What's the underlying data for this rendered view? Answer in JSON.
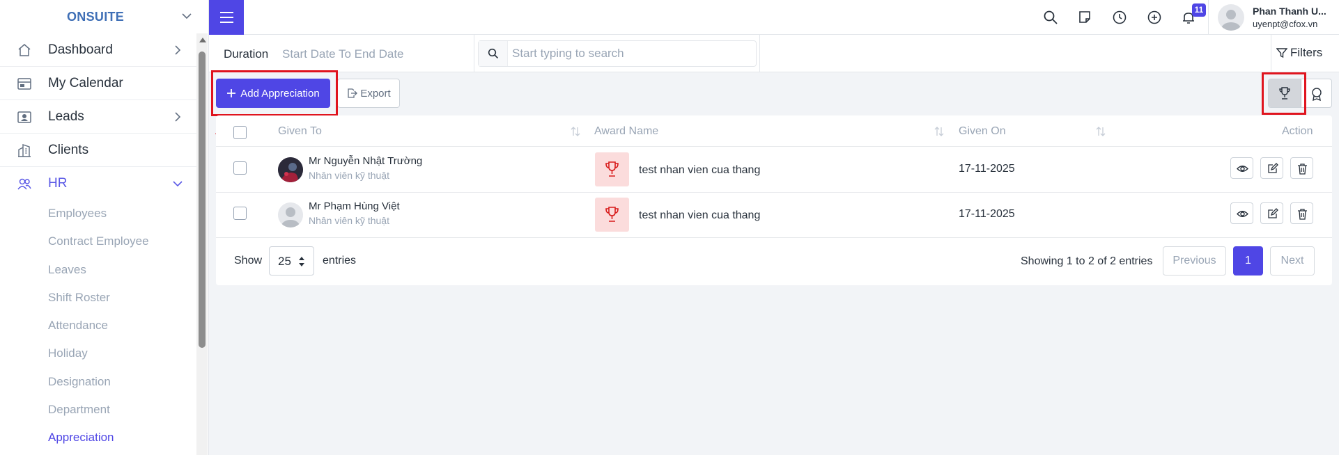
{
  "sidebar": {
    "brand": "ONSUITE",
    "menu": [
      {
        "label": "Dashboard",
        "icon": "home-icon"
      },
      {
        "label": "My Calendar",
        "icon": "calendar-icon"
      },
      {
        "label": "Leads",
        "icon": "leads-icon"
      },
      {
        "label": "Clients",
        "icon": "building-icon"
      },
      {
        "label": "HR",
        "icon": "users-icon"
      }
    ],
    "hr_submenu": [
      "Employees",
      "Contract Employee",
      "Leaves",
      "Shift Roster",
      "Attendance",
      "Holiday",
      "Designation",
      "Department",
      "Appreciation"
    ]
  },
  "topbar": {
    "notification_count": "11",
    "user_name": "Phan Thanh U...",
    "user_email": "uyenpt@cfox.vn"
  },
  "filters": {
    "duration_label": "Duration",
    "duration_value": "Start Date To End Date",
    "search_placeholder": "Start typing to search",
    "filters_label": "Filters"
  },
  "actions": {
    "add_label": "Add Appreciation",
    "export_label": "Export"
  },
  "table": {
    "columns": [
      "Given To",
      "Award Name",
      "Given On",
      "Action"
    ],
    "rows": [
      {
        "name": "Mr Nguyễn Nhật Trường",
        "role": "Nhân viên kỹ thuật",
        "award": "test nhan vien cua thang",
        "date": "17-11-2025"
      },
      {
        "name": "Mr Phạm Hùng Việt",
        "role": "Nhân viên kỹ thuật",
        "award": "test nhan vien cua thang",
        "date": "17-11-2025"
      }
    ]
  },
  "pagination": {
    "show_label": "Show",
    "page_size": "25",
    "entries_label": "entries",
    "info": "Showing 1 to 2 of 2 entries",
    "previous": "Previous",
    "current": "1",
    "next": "Next"
  },
  "colors": {
    "accent": "#4f46e5",
    "highlight": "#e0141e",
    "muted": "#99a5b5"
  }
}
